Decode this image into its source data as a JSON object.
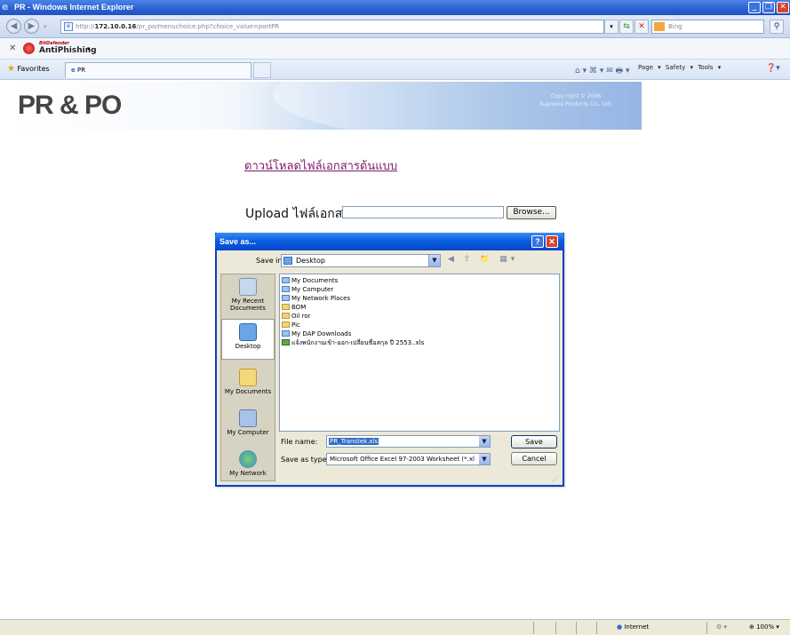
{
  "window": {
    "title": "PR - Windows Internet Explorer"
  },
  "addressbar": {
    "url_prefix": "http://",
    "url_host": "172.10.0.16",
    "url_path": "/pr_po/menuchoice.php?choice_value=portPR",
    "search_placeholder": "Bing"
  },
  "antiphishing": {
    "brand_small": "BitDefender",
    "label": "AntiPhishing"
  },
  "favbar": {
    "favorites": "Favorites",
    "tab_title": "PR",
    "commands": "Page ▾  Safety ▾  Tools ▾"
  },
  "page": {
    "logo": "PR & PO",
    "copyright_line1": "Copy right © 2006",
    "copyright_line2": "Supreme Products Co., Ltd.",
    "download_link": "ดาวน์โหลดไฟล์เอกสารต้นแบบ",
    "upload_label": "Upload ไฟล์เอกสาร",
    "browse_button": "Browse..."
  },
  "dialog": {
    "title": "Save as...",
    "save_in_label": "Save in:",
    "save_in_value": "Desktop",
    "places": [
      {
        "label": "My Recent Documents"
      },
      {
        "label": "Desktop"
      },
      {
        "label": "My Documents"
      },
      {
        "label": "My Computer"
      },
      {
        "label": "My Network"
      }
    ],
    "files": [
      {
        "name": "My Documents",
        "type": "doc"
      },
      {
        "name": "My Computer",
        "type": "doc"
      },
      {
        "name": "My Network Places",
        "type": "doc"
      },
      {
        "name": "BOM",
        "type": "folder"
      },
      {
        "name": "Oil ror",
        "type": "folder"
      },
      {
        "name": "Pic",
        "type": "folder"
      },
      {
        "name": "My DAP Downloads",
        "type": "doc"
      },
      {
        "name": "แจ้งพนักงานเข้า-ออก-เปลี่ยนชื่อสกุล ปี 2553..xls",
        "type": "xls"
      }
    ],
    "file_name_label": "File name:",
    "file_name_value": "PR_Transtek.xls",
    "save_as_type_label": "Save as type:",
    "save_as_type_value": "Microsoft Office Excel 97-2003 Worksheet (*.xl",
    "save_button": "Save",
    "cancel_button": "Cancel"
  },
  "statusbar": {
    "zone": "Internet",
    "zoom": "100%"
  }
}
